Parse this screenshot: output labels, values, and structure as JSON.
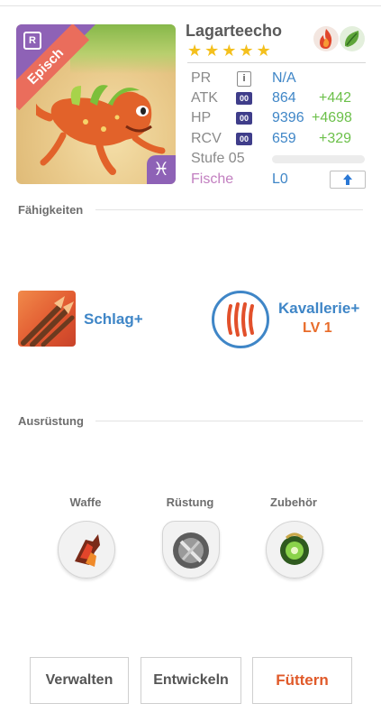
{
  "hero": {
    "name": "Lagarteecho",
    "rarity": "Episch",
    "rarity_color": "#8e62b6",
    "ribbon_color": "#ea6d5c",
    "corner_badge": "R",
    "star_count": 5,
    "stars": [
      "★",
      "★",
      "★",
      "★",
      "★"
    ],
    "zodiac_icon": "pisces-icon",
    "zodiac_glyph": "♓︎",
    "elements": [
      "fire-element-icon",
      "leaf-element-icon"
    ]
  },
  "stats": {
    "pr_label": "PR",
    "pr_value": "N/A",
    "info_glyph": "i",
    "atk_label": "ATK",
    "atk_badge": "00",
    "atk_value": "864",
    "atk_bonus": "+442",
    "hp_label": "HP",
    "hp_badge": "00",
    "hp_value": "9396",
    "hp_bonus": "+4698",
    "rcv_label": "RCV",
    "rcv_badge": "00",
    "rcv_value": "659",
    "rcv_bonus": "+329",
    "level_label": "Stufe 05",
    "level_progress": 0,
    "fish_label": "Fische",
    "fish_value": "L0",
    "upgrade_icon": "upload-arrow-icon",
    "upgrade_glyph": "🡅"
  },
  "abilities": {
    "title": "Fähigkeiten",
    "skill1_name": "Schlag+",
    "skill2_name": "Kavallerie+",
    "skill2_level": "LV 1"
  },
  "equipment": {
    "title": "Ausrüstung",
    "slots": [
      {
        "label": "Waffe",
        "icon": "weapon-icon"
      },
      {
        "label": "Rüstung",
        "icon": "armor-icon"
      },
      {
        "label": "Zubehör",
        "icon": "accessory-icon"
      }
    ]
  },
  "buttons": {
    "manage": "Verwalten",
    "evolve": "Entwickeln",
    "feed": "Füttern"
  },
  "colors": {
    "accent_blue": "#3f86c7",
    "bonus_green": "#6cc04a",
    "feed_orange": "#e05a2a",
    "star_yellow": "#f4c01d",
    "fish_purple": "#c27fc0"
  }
}
